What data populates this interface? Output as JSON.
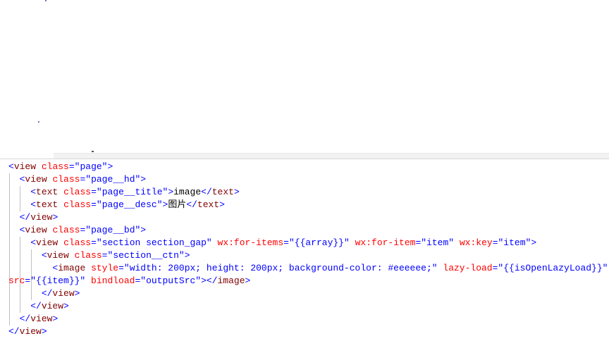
{
  "code_lines": [
    {
      "indent": "",
      "parts": [
        [
          "punct",
          "<"
        ],
        [
          "tag",
          "view"
        ],
        [
          "txt",
          " "
        ],
        [
          "attr",
          "class"
        ],
        [
          "punct",
          "="
        ],
        [
          "val",
          "\"page\""
        ],
        [
          "punct",
          ">"
        ]
      ]
    },
    {
      "indent": "  ",
      "parts": [
        [
          "punct",
          "<"
        ],
        [
          "tag",
          "view"
        ],
        [
          "txt",
          " "
        ],
        [
          "attr",
          "class"
        ],
        [
          "punct",
          "="
        ],
        [
          "val",
          "\"page__hd\""
        ],
        [
          "punct",
          ">"
        ]
      ]
    },
    {
      "indent": "    ",
      "parts": [
        [
          "punct",
          "<"
        ],
        [
          "tag",
          "text"
        ],
        [
          "txt",
          " "
        ],
        [
          "attr",
          "class"
        ],
        [
          "punct",
          "="
        ],
        [
          "val",
          "\"page__title\""
        ],
        [
          "punct",
          ">"
        ],
        [
          "txt",
          "image"
        ],
        [
          "punct",
          "</"
        ],
        [
          "tag",
          "text"
        ],
        [
          "punct",
          ">"
        ]
      ]
    },
    {
      "indent": "    ",
      "parts": [
        [
          "punct",
          "<"
        ],
        [
          "tag",
          "text"
        ],
        [
          "txt",
          " "
        ],
        [
          "attr",
          "class"
        ],
        [
          "punct",
          "="
        ],
        [
          "val",
          "\"page__desc\""
        ],
        [
          "punct",
          ">"
        ],
        [
          "txt",
          "图片"
        ],
        [
          "punct",
          "</"
        ],
        [
          "tag",
          "text"
        ],
        [
          "punct",
          ">"
        ]
      ]
    },
    {
      "indent": "  ",
      "parts": [
        [
          "punct",
          "</"
        ],
        [
          "tag",
          "view"
        ],
        [
          "punct",
          ">"
        ]
      ]
    },
    {
      "indent": "  ",
      "parts": [
        [
          "punct",
          "<"
        ],
        [
          "tag",
          "view"
        ],
        [
          "txt",
          " "
        ],
        [
          "attr",
          "class"
        ],
        [
          "punct",
          "="
        ],
        [
          "val",
          "\"page__bd\""
        ],
        [
          "punct",
          ">"
        ]
      ]
    },
    {
      "indent": "    ",
      "parts": [
        [
          "punct",
          "<"
        ],
        [
          "tag",
          "view"
        ],
        [
          "txt",
          " "
        ],
        [
          "attr",
          "class"
        ],
        [
          "punct",
          "="
        ],
        [
          "val",
          "\"section section_gap\""
        ],
        [
          "txt",
          " "
        ],
        [
          "attr",
          "wx:for-items"
        ],
        [
          "punct",
          "="
        ],
        [
          "val",
          "\"{{array}}\""
        ],
        [
          "txt",
          " "
        ],
        [
          "attr",
          "wx:for-item"
        ],
        [
          "punct",
          "="
        ],
        [
          "val",
          "\"item\""
        ],
        [
          "txt",
          " "
        ],
        [
          "attr",
          "wx:key"
        ],
        [
          "punct",
          "="
        ],
        [
          "val",
          "\"item\""
        ],
        [
          "punct",
          ">"
        ]
      ]
    },
    {
      "indent": "      ",
      "parts": [
        [
          "punct",
          "<"
        ],
        [
          "tag",
          "view"
        ],
        [
          "txt",
          " "
        ],
        [
          "attr",
          "class"
        ],
        [
          "punct",
          "="
        ],
        [
          "val",
          "\"section__ctn\""
        ],
        [
          "punct",
          ">"
        ]
      ]
    },
    {
      "indent": "        ",
      "parts": [
        [
          "punct",
          "<"
        ],
        [
          "tag",
          "image"
        ],
        [
          "txt",
          " "
        ],
        [
          "attr",
          "style"
        ],
        [
          "punct",
          "="
        ],
        [
          "val",
          "\"width: 200px; height: 200px; background-color: #eeeeee;\""
        ],
        [
          "txt",
          " "
        ],
        [
          "attr",
          "lazy-load"
        ],
        [
          "punct",
          "="
        ],
        [
          "val",
          "\"{{isOpenLazyLoad}}\""
        ]
      ]
    },
    {
      "indent": "",
      "parts": [
        [
          "attr",
          "src"
        ],
        [
          "punct",
          "="
        ],
        [
          "val",
          "\"{{item}}\""
        ],
        [
          "txt",
          " "
        ],
        [
          "attr",
          "bindload"
        ],
        [
          "punct",
          "="
        ],
        [
          "val",
          "\"outputSrc\""
        ],
        [
          "punct",
          "></"
        ],
        [
          "tag",
          "image"
        ],
        [
          "punct",
          ">"
        ]
      ]
    },
    {
      "indent": "      ",
      "parts": [
        [
          "punct",
          "</"
        ],
        [
          "tag",
          "view"
        ],
        [
          "punct",
          ">"
        ]
      ]
    },
    {
      "indent": "    ",
      "parts": [
        [
          "punct",
          "</"
        ],
        [
          "tag",
          "view"
        ],
        [
          "punct",
          ">"
        ]
      ]
    },
    {
      "indent": "  ",
      "parts": [
        [
          "punct",
          "</"
        ],
        [
          "tag",
          "view"
        ],
        [
          "punct",
          ">"
        ]
      ]
    },
    {
      "indent": "",
      "parts": [
        [
          "punct",
          "</"
        ],
        [
          "tag",
          "view"
        ],
        [
          "punct",
          ">"
        ]
      ]
    }
  ],
  "colors": {
    "tag": "#800000",
    "attribute": "#ff0000",
    "value": "#0000ff",
    "text": "#000000"
  }
}
